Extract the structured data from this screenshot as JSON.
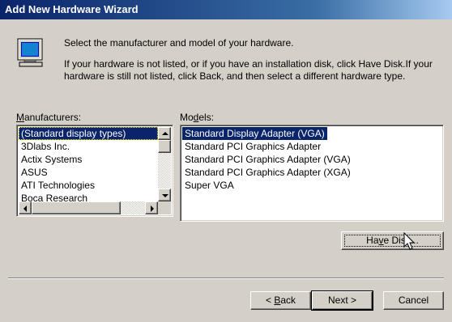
{
  "window": {
    "title": "Add New Hardware Wizard"
  },
  "header": {
    "icon": "monitor-icon",
    "line1": "Select the manufacturer and model of your hardware.",
    "line2": "If your hardware is not listed, or if you have an installation disk, click Have Disk.If your hardware is still not listed, click Back, and then select a different hardware type."
  },
  "manufacturers": {
    "label_prefix": "M",
    "label_rest": "anufacturers:",
    "items": [
      "(Standard display types)",
      "3Dlabs Inc.",
      "Actix Systems",
      "ASUS",
      "ATI Technologies",
      "Boca Research"
    ],
    "selected": "(Standard display types)"
  },
  "models": {
    "label_prefix": "Mo",
    "label_accel": "d",
    "label_rest": "els:",
    "items": [
      "Standard Display Adapter (VGA)",
      "Standard PCI Graphics Adapter",
      "Standard PCI Graphics Adapter (VGA)",
      "Standard PCI Graphics Adapter (XGA)",
      "Super VGA"
    ],
    "selected": "Standard Display Adapter (VGA)"
  },
  "buttons": {
    "have_disk_prefix": "Ha",
    "have_disk_accel": "v",
    "have_disk_rest": "e Disk...",
    "back_prefix": "< ",
    "back_accel": "B",
    "back_rest": "ack",
    "next": "Next >",
    "cancel": "Cancel"
  },
  "colors": {
    "face": "#d4d0c8",
    "selection": "#0a246a",
    "title_start": "#0a246a",
    "title_end": "#a6caf0"
  }
}
